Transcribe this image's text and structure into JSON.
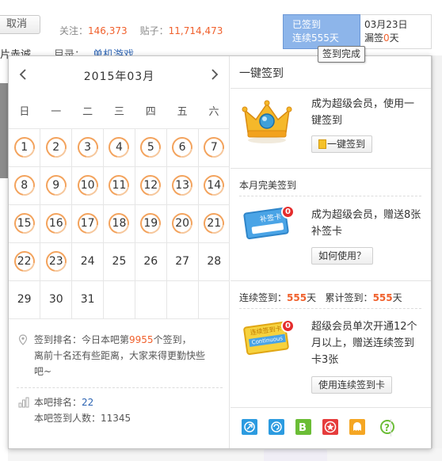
{
  "header": {
    "cancel_label": "取消",
    "follow_label": "关注：",
    "follow_count": "146,373",
    "posts_label": "贴子：",
    "posts_count": "11,714,473",
    "left_fragment": "片赤诚",
    "catalog_label": "目录：",
    "catalog_link": "单机游戏"
  },
  "signin": {
    "status": "已签到",
    "streak": "连续555天",
    "date": "03月23日",
    "missed_prefix": "漏签",
    "missed_count": "0",
    "missed_suffix": "天",
    "tooltip": "签到完成"
  },
  "calendar": {
    "title": "2015年03月",
    "weekdays": [
      "日",
      "一",
      "二",
      "三",
      "四",
      "五",
      "六"
    ],
    "weeks": [
      [
        {
          "d": "1",
          "s": true
        },
        {
          "d": "2",
          "s": true
        },
        {
          "d": "3",
          "s": true
        },
        {
          "d": "4",
          "s": true
        },
        {
          "d": "5",
          "s": true
        },
        {
          "d": "6",
          "s": true
        },
        {
          "d": "7",
          "s": true
        }
      ],
      [
        {
          "d": "8",
          "s": true
        },
        {
          "d": "9",
          "s": true
        },
        {
          "d": "10",
          "s": true
        },
        {
          "d": "11",
          "s": true
        },
        {
          "d": "12",
          "s": true
        },
        {
          "d": "13",
          "s": true
        },
        {
          "d": "14",
          "s": true
        }
      ],
      [
        {
          "d": "15",
          "s": true
        },
        {
          "d": "16",
          "s": true
        },
        {
          "d": "17",
          "s": true
        },
        {
          "d": "18",
          "s": true
        },
        {
          "d": "19",
          "s": true
        },
        {
          "d": "20",
          "s": true
        },
        {
          "d": "21",
          "s": true
        }
      ],
      [
        {
          "d": "22",
          "s": true
        },
        {
          "d": "23",
          "s": true
        },
        {
          "d": "24",
          "s": false
        },
        {
          "d": "25",
          "s": false
        },
        {
          "d": "26",
          "s": false
        },
        {
          "d": "27",
          "s": false
        },
        {
          "d": "28",
          "s": false
        }
      ],
      [
        {
          "d": "29",
          "s": false
        },
        {
          "d": "30",
          "s": false
        },
        {
          "d": "31",
          "s": false
        },
        {
          "d": "",
          "s": false
        },
        {
          "d": "",
          "s": false
        },
        {
          "d": "",
          "s": false
        },
        {
          "d": "",
          "s": false
        }
      ]
    ]
  },
  "rank": {
    "line1_prefix": "签到排名：今日本吧第",
    "line1_num": "9955",
    "line1_suffix": "个签到，",
    "line2": "离前十名还有些距离，大家来得更勤快些",
    "line3": "吧~",
    "bar_rank_label": "本吧排名：",
    "bar_rank_value": "22",
    "bar_count_label": "本吧签到人数：",
    "bar_count_value": "11345"
  },
  "side": {
    "title": "一键签到",
    "vip_text": "成为超级会员，使用一键签到",
    "vip_button": "一键签到",
    "perfect_title": "本月完美签到",
    "card_badge": "0",
    "card_label": "补签卡",
    "perfect_text": "成为超级会员，赠送8张补签卡",
    "perfect_button": "如何使用？",
    "streak_label": "连续签到：",
    "streak_value": "555",
    "streak_unit": "天",
    "total_label": "累计签到：",
    "total_value": "555",
    "total_unit": "天",
    "cont_badge": "0",
    "cont_card_label": "连续签到卡",
    "cont_card_en": "Continuous",
    "cont_text": "超级会员单次开通12个月以上，赠送连续签到卡3张",
    "cont_button": "使用连续签到卡"
  },
  "colors": {
    "accent_orange": "#f0602c",
    "link_blue": "#2d64b3",
    "signed_blue": "#8db5ea"
  }
}
